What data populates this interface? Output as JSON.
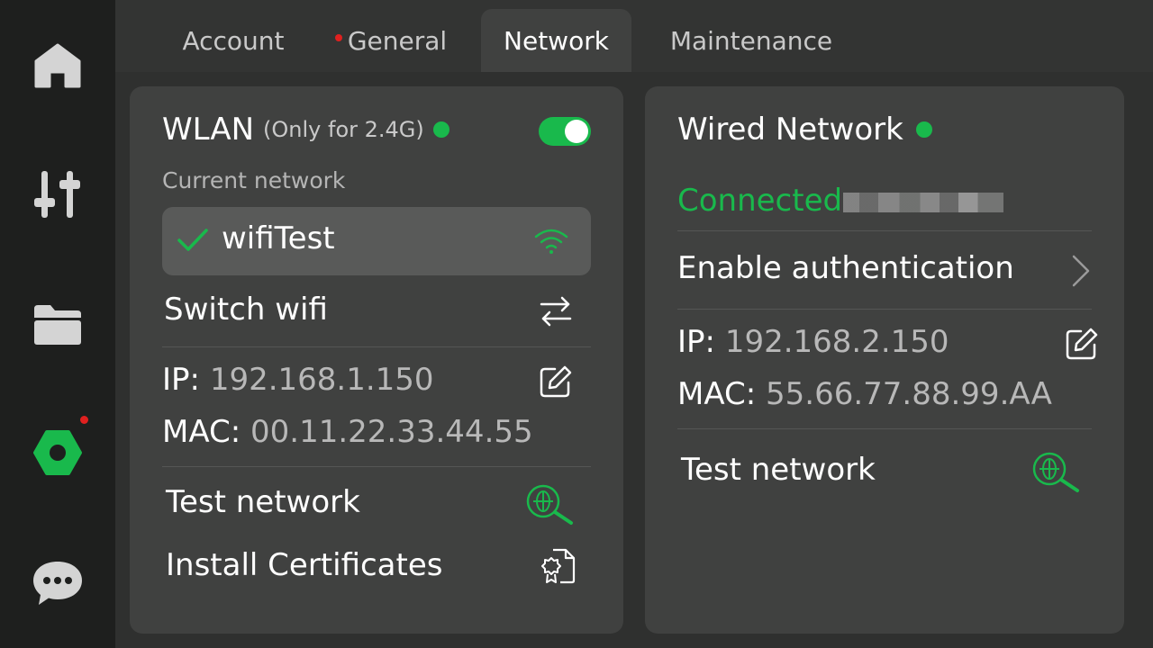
{
  "sidebar": {
    "items": [
      {
        "name": "home",
        "icon": "home-icon"
      },
      {
        "name": "controls",
        "icon": "sliders-icon"
      },
      {
        "name": "files",
        "icon": "folder-icon"
      },
      {
        "name": "settings",
        "icon": "settings-hex-icon",
        "active": true,
        "badge": true
      },
      {
        "name": "messages",
        "icon": "chat-bubble-icon"
      }
    ]
  },
  "tabs": [
    {
      "label": "Account",
      "active": false,
      "badge": false
    },
    {
      "label": "General",
      "active": false,
      "badge": true
    },
    {
      "label": "Network",
      "active": true,
      "badge": false
    },
    {
      "label": "Maintenance",
      "active": false,
      "badge": false
    }
  ],
  "wlan": {
    "title": "WLAN",
    "note": "(Only for 2.4G)",
    "enabled": true,
    "current_network_label": "Current network",
    "current_network": "wifiTest",
    "switch_label": "Switch wifi",
    "ip_label": "IP:",
    "ip_value": "192.168.1.150",
    "mac_label": "MAC:",
    "mac_value": "00.11.22.33.44.55",
    "test_label": "Test network",
    "cert_label": "Install Certificates"
  },
  "wired": {
    "title": "Wired Network",
    "status": "Connected",
    "auth_label": "Enable authentication",
    "ip_label": "IP:",
    "ip_value": "192.168.2.150",
    "mac_label": "MAC:",
    "mac_value": "55.66.77.88.99.AA",
    "test_label": "Test network"
  },
  "colors": {
    "accent": "#19b94c",
    "badge": "#e0201f",
    "card": "#404140",
    "sidebar": "#1e1f1e"
  }
}
